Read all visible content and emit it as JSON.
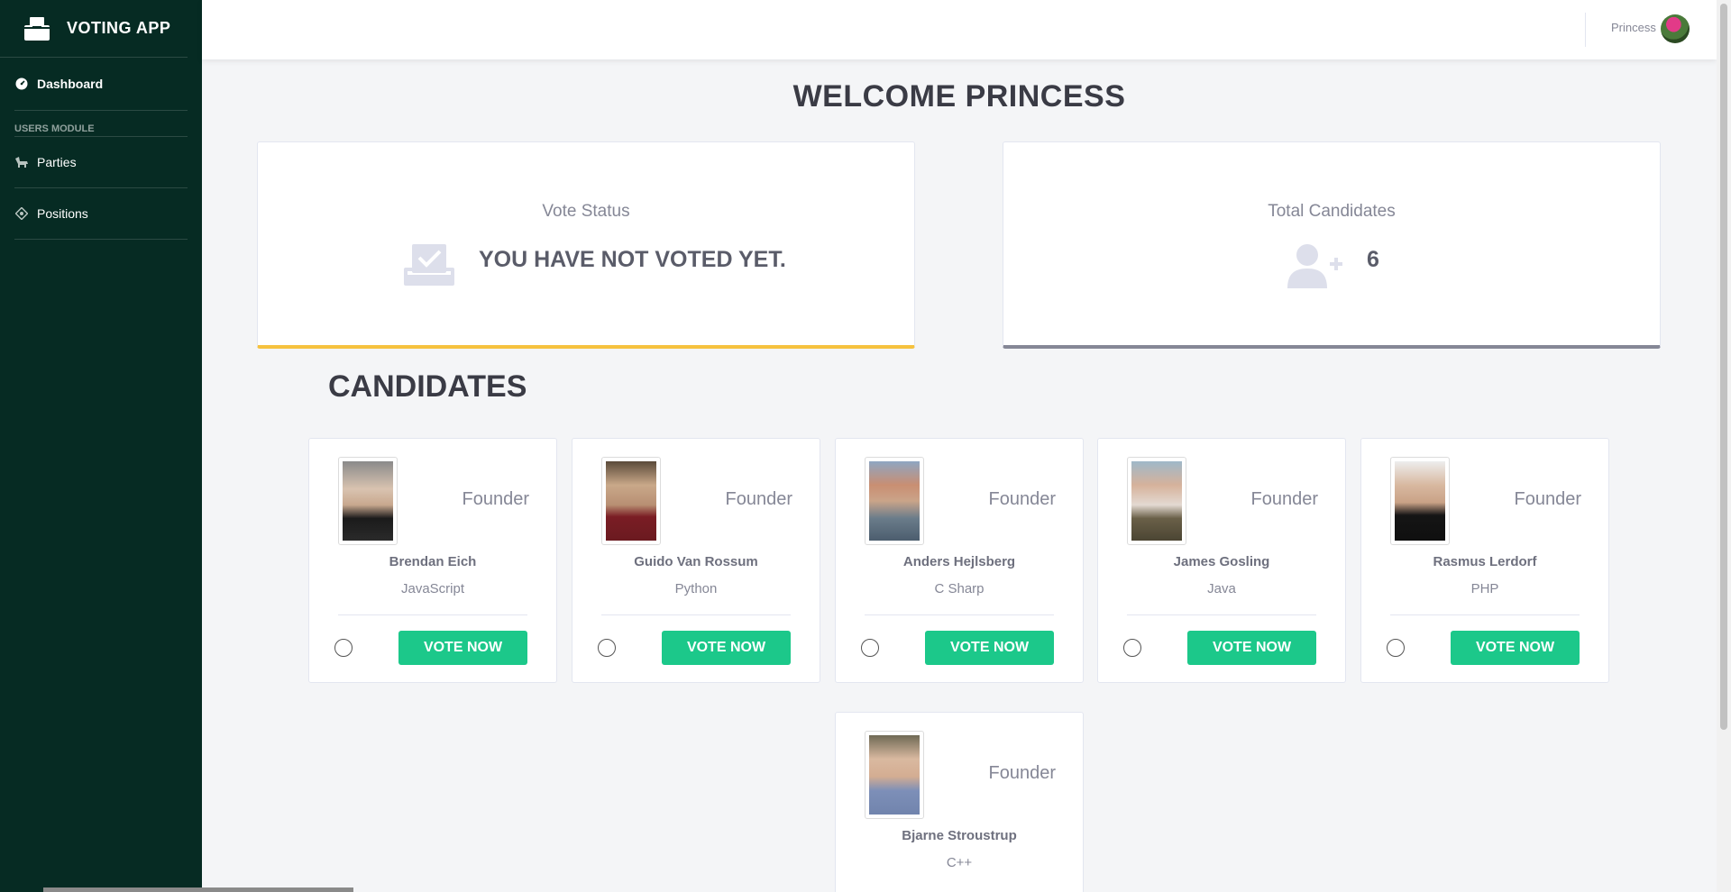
{
  "sidebar": {
    "brand": "VOTING APP",
    "nav": [
      {
        "label": "Dashboard",
        "icon": "dashboard-icon"
      },
      {
        "label": "Parties",
        "icon": "parties-icon"
      },
      {
        "label": "Positions",
        "icon": "positions-icon"
      }
    ],
    "section_heading": "USERS MODULE"
  },
  "topbar": {
    "user_name": "Princess"
  },
  "main": {
    "welcome": "WELCOME PRINCESS",
    "vote_status": {
      "title": "Vote Status",
      "value": "YOU HAVE NOT VOTED YET.",
      "accent": "#f6c23e"
    },
    "total_candidates": {
      "title": "Total Candidates",
      "value": "6",
      "accent": "#858796"
    },
    "candidates_title": "CANDIDATES",
    "vote_button_label": "VOTE NOW",
    "candidates": [
      {
        "name": "Brendan Eich",
        "language": "JavaScript",
        "role": "Founder"
      },
      {
        "name": "Guido Van Rossum",
        "language": "Python",
        "role": "Founder"
      },
      {
        "name": "Anders Hejlsberg",
        "language": "C Sharp",
        "role": "Founder"
      },
      {
        "name": "James Gosling",
        "language": "Java",
        "role": "Founder"
      },
      {
        "name": "Rasmus Lerdorf",
        "language": "PHP",
        "role": "Founder"
      },
      {
        "name": "Bjarne Stroustrup",
        "language": "C++",
        "role": "Founder"
      }
    ]
  },
  "colors": {
    "sidebar_bg": "#062b23",
    "vote_button": "#1cc88a"
  }
}
